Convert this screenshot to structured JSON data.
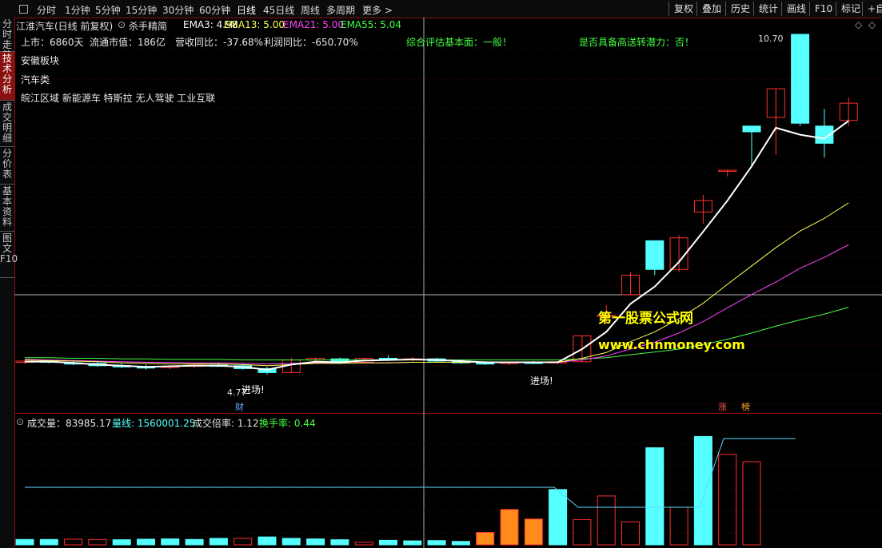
{
  "toolbar": {
    "periods": [
      "分时",
      "1分钟",
      "5分钟",
      "15分钟",
      "30分钟",
      "60分钟",
      "日线",
      "45日线",
      "周线",
      "多周期",
      "更多"
    ],
    "active_period": "日线",
    "right_buttons": [
      "复权",
      "叠加",
      "历史",
      "统计",
      "画线",
      "F10",
      "标记",
      "+自"
    ]
  },
  "sidebar": {
    "tabs": [
      "分时走势",
      "技术分析",
      "成交明细",
      "分价表",
      "基本资料",
      "图文F10"
    ],
    "active": "技术分析"
  },
  "header": {
    "stock": "江淮汽车(日线 前复权)",
    "indicator": "杀手精简",
    "ema3": "EMA3: 4.98",
    "ema13": "EMA13: 5.00",
    "ema21": "EMA21: 5.00",
    "ema55": "EMA55: 5.04"
  },
  "info": {
    "listed": "上市：6860天",
    "market_cap": "流通市值：186亿",
    "revenue": "营收同比：-37.68%",
    "profit": "利润同比：-650.70%",
    "rating": "综合评估基本面：一般！",
    "bonus": "是否具备高送转潜力：否！"
  },
  "stock_info": {
    "sector": "安徽板块",
    "category": "汽车类",
    "concepts": "皖江区域 新能源车 特斯拉 无人驾驶 工业互联"
  },
  "chart_labels": {
    "high": "10.70",
    "low": "4.77",
    "entry1": "进场!",
    "entry2": "进场!",
    "cai": "财",
    "zhang": "涨",
    "bang": "榜",
    "watermark1": "第一股票公式网",
    "watermark2": "www.chnmoney.com"
  },
  "volume_header": {
    "volume": "成交量：83985.17",
    "ratio_line": "量线: 1560001.25",
    "multiple": "成交倍率: 1.12",
    "turnover": "换手率: 0.44"
  },
  "colors": {
    "up": "#ff3030",
    "down": "#55ffff",
    "ema3": "#ffffff",
    "ema13": "#ffff55",
    "ema21": "#ff44ff",
    "ema55": "#44ff44",
    "accent_red": "#8a1010",
    "vol_orange": "#ff8c1a"
  },
  "chart_data": {
    "type": "candlestick",
    "note": "daily OHLC, price units (yuan)",
    "candles": [
      {
        "o": 4.98,
        "h": 5.02,
        "l": 4.95,
        "c": 5.0
      },
      {
        "o": 5.0,
        "h": 5.02,
        "l": 4.96,
        "c": 4.98
      },
      {
        "o": 4.97,
        "h": 5.0,
        "l": 4.93,
        "c": 4.96
      },
      {
        "o": 4.96,
        "h": 4.99,
        "l": 4.9,
        "c": 4.92
      },
      {
        "o": 4.92,
        "h": 4.96,
        "l": 4.88,
        "c": 4.9
      },
      {
        "o": 4.9,
        "h": 4.94,
        "l": 4.85,
        "c": 4.88
      },
      {
        "o": 4.89,
        "h": 4.93,
        "l": 4.86,
        "c": 4.91
      },
      {
        "o": 4.91,
        "h": 4.95,
        "l": 4.88,
        "c": 4.93
      },
      {
        "o": 4.93,
        "h": 4.97,
        "l": 4.9,
        "c": 4.92
      },
      {
        "o": 4.92,
        "h": 4.95,
        "l": 4.85,
        "c": 4.87
      },
      {
        "o": 4.87,
        "h": 4.9,
        "l": 4.77,
        "c": 4.8
      },
      {
        "o": 4.8,
        "h": 5.06,
        "l": 4.79,
        "c": 5.02
      },
      {
        "o": 5.02,
        "h": 5.06,
        "l": 4.97,
        "c": 5.05
      },
      {
        "o": 5.04,
        "h": 5.06,
        "l": 4.95,
        "c": 4.97
      },
      {
        "o": 4.98,
        "h": 5.06,
        "l": 4.96,
        "c": 5.05
      },
      {
        "o": 5.05,
        "h": 5.1,
        "l": 5.0,
        "c": 5.03
      },
      {
        "o": 5.03,
        "h": 5.07,
        "l": 4.99,
        "c": 5.04
      },
      {
        "o": 5.04,
        "h": 5.06,
        "l": 4.98,
        "c": 5.0
      },
      {
        "o": 5.0,
        "h": 5.03,
        "l": 4.95,
        "c": 4.97
      },
      {
        "o": 4.97,
        "h": 5.0,
        "l": 4.93,
        "c": 4.96
      },
      {
        "o": 4.96,
        "h": 4.99,
        "l": 4.93,
        "c": 4.98
      },
      {
        "o": 4.98,
        "h": 5.0,
        "l": 4.95,
        "c": 4.97
      },
      {
        "o": 4.97,
        "h": 5.0,
        "l": 4.95,
        "c": 4.99
      },
      {
        "o": 4.99,
        "h": 5.44,
        "l": 4.99,
        "c": 5.44
      },
      {
        "o": 5.8,
        "h": 5.98,
        "l": 5.66,
        "c": 5.8
      },
      {
        "o": 6.16,
        "h": 6.55,
        "l": 6.16,
        "c": 6.5
      },
      {
        "o": 7.1,
        "h": 7.1,
        "l": 6.5,
        "c": 6.6
      },
      {
        "o": 6.6,
        "h": 7.2,
        "l": 6.55,
        "c": 7.15
      },
      {
        "o": 7.6,
        "h": 7.9,
        "l": 7.4,
        "c": 7.8
      },
      {
        "o": 8.33,
        "h": 8.33,
        "l": 8.22,
        "c": 8.33
      },
      {
        "o": 9.1,
        "h": 9.1,
        "l": 8.4,
        "c": 9.0
      },
      {
        "o": 9.25,
        "h": 9.75,
        "l": 8.6,
        "c": 9.75
      },
      {
        "o": 10.7,
        "h": 10.7,
        "l": 9.1,
        "c": 9.15
      },
      {
        "o": 9.1,
        "h": 9.4,
        "l": 8.55,
        "c": 8.8
      },
      {
        "o": 9.2,
        "h": 9.6,
        "l": 9.1,
        "c": 9.5
      }
    ],
    "ema3": [
      4.99,
      4.99,
      4.97,
      4.94,
      4.92,
      4.9,
      4.91,
      4.92,
      4.92,
      4.9,
      4.85,
      4.94,
      4.99,
      4.98,
      5.01,
      5.02,
      5.03,
      5.02,
      5.0,
      4.98,
      4.98,
      4.98,
      4.98,
      5.21,
      5.51,
      6.0,
      6.3,
      6.73,
      7.26,
      7.8,
      8.4,
      9.07,
      8.95,
      8.88,
      9.19
    ],
    "ema13": [
      5.02,
      5.01,
      5.0,
      4.99,
      4.97,
      4.96,
      4.95,
      4.95,
      4.95,
      4.94,
      4.92,
      4.94,
      4.96,
      4.96,
      4.97,
      4.97,
      4.98,
      4.98,
      4.98,
      4.98,
      4.98,
      4.98,
      4.98,
      5.05,
      5.15,
      5.34,
      5.51,
      5.74,
      6.01,
      6.34,
      6.66,
      6.98,
      7.27,
      7.49,
      7.76
    ],
    "ema21": [
      5.03,
      5.02,
      5.01,
      5.0,
      4.99,
      4.98,
      4.98,
      4.97,
      4.97,
      4.96,
      4.95,
      4.96,
      4.97,
      4.97,
      4.97,
      4.97,
      4.98,
      4.98,
      4.98,
      4.98,
      4.98,
      4.98,
      4.98,
      5.02,
      5.09,
      5.21,
      5.33,
      5.49,
      5.69,
      5.93,
      6.16,
      6.38,
      6.62,
      6.81,
      7.03
    ],
    "ema55": [
      5.06,
      5.06,
      5.05,
      5.05,
      5.04,
      5.04,
      5.03,
      5.03,
      5.03,
      5.02,
      5.02,
      5.02,
      5.02,
      5.02,
      5.02,
      5.02,
      5.02,
      5.02,
      5.02,
      5.02,
      5.02,
      5.02,
      5.02,
      5.04,
      5.06,
      5.11,
      5.16,
      5.21,
      5.29,
      5.38,
      5.49,
      5.61,
      5.72,
      5.82,
      5.94
    ],
    "volume": [
      {
        "v": 0.95,
        "up": false
      },
      {
        "v": 0.95,
        "up": false
      },
      {
        "v": 1.0,
        "up": true
      },
      {
        "v": 0.95,
        "up": true
      },
      {
        "v": 0.9,
        "up": false
      },
      {
        "v": 1.0,
        "up": false
      },
      {
        "v": 1.05,
        "up": false
      },
      {
        "v": 0.95,
        "up": false
      },
      {
        "v": 1.15,
        "up": false
      },
      {
        "v": 1.15,
        "up": true
      },
      {
        "v": 1.4,
        "up": false
      },
      {
        "v": 1.15,
        "up": false
      },
      {
        "v": 1.05,
        "up": false
      },
      {
        "v": 0.9,
        "up": false
      },
      {
        "v": 0.45,
        "up": true
      },
      {
        "v": 0.8,
        "up": false
      },
      {
        "v": 0.7,
        "up": false
      },
      {
        "v": 0.75,
        "up": false
      },
      {
        "v": 0.6,
        "up": false
      },
      {
        "v": 2.2,
        "up": true
      },
      {
        "v": 6.3,
        "up": true
      },
      {
        "v": 4.6,
        "up": true
      },
      {
        "v": 9.85,
        "up": false
      },
      {
        "v": 4.5,
        "up": true
      },
      {
        "v": 8.7,
        "up": true
      },
      {
        "v": 4.1,
        "up": true
      },
      {
        "v": 17.3,
        "up": false
      },
      {
        "v": 6.7,
        "up": true
      },
      {
        "v": 19.3,
        "up": false
      },
      {
        "v": 16.1,
        "up": true
      },
      {
        "v": 14.8,
        "up": true
      }
    ]
  }
}
